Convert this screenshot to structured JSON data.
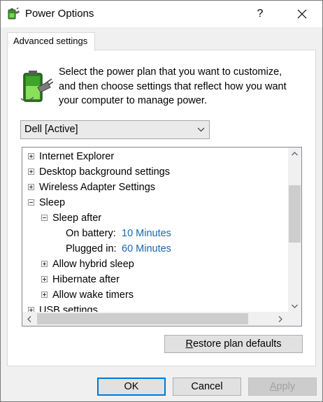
{
  "window": {
    "title": "Power Options",
    "help_glyph": "?",
    "close_glyph": "✕"
  },
  "tab": {
    "label": "Advanced settings"
  },
  "description": {
    "line1": "Select the power plan that you want to customize,",
    "line2": "and then choose settings that reflect how you want",
    "line3": "your computer to manage power."
  },
  "plan_select": {
    "selected": "Dell [Active]"
  },
  "tree": {
    "items": [
      {
        "label": "Internet Explorer",
        "state": "collapsed"
      },
      {
        "label": "Desktop background settings",
        "state": "collapsed"
      },
      {
        "label": "Wireless Adapter Settings",
        "state": "collapsed"
      },
      {
        "label": "Sleep",
        "state": "expanded"
      },
      {
        "label": "Sleep after",
        "state": "expanded"
      },
      {
        "label": "On battery:",
        "value": "10 Minutes"
      },
      {
        "label": "Plugged in:",
        "value": "60 Minutes"
      },
      {
        "label": "Allow hybrid sleep",
        "state": "collapsed"
      },
      {
        "label": "Hibernate after",
        "state": "collapsed"
      },
      {
        "label": "Allow wake timers",
        "state": "collapsed"
      },
      {
        "label": "USB settings",
        "state": "collapsed"
      }
    ]
  },
  "buttons": {
    "restore_first": "R",
    "restore_rest": "estore plan defaults",
    "ok": "OK",
    "cancel": "Cancel",
    "apply_first": "A",
    "apply_rest": "pply"
  },
  "icons": {
    "app": "power-options-icon",
    "battery": "battery-plug-icon"
  },
  "colors": {
    "link_value": "#1467b3",
    "focus_border": "#0078d7"
  }
}
